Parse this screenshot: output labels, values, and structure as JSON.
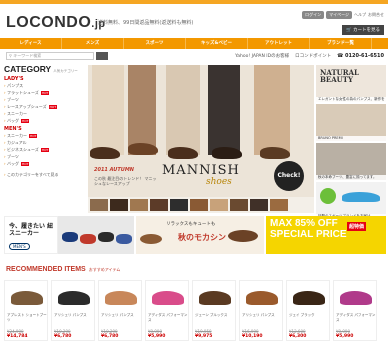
{
  "header": {
    "logo": "LOCONDO",
    "logo_suffix": ".jp",
    "tagline": "送料無料、99日間返品無料(返送料も無料)",
    "login_label": "ログイン",
    "register_label": "マイページ",
    "help_label": "ヘルプ",
    "guide_label": "お問合せ",
    "cart_label": "カートを見る"
  },
  "nav": {
    "items": [
      "レディース",
      "メンズ",
      "スポーツ",
      "キッズ&ベビー",
      "アウトレット",
      "ブランド一覧"
    ]
  },
  "searchbar": {
    "placeholder": "キーワード検索",
    "yahoo_label": "Yahoo! JAPAN IDのお客様",
    "point_label": "ロコンドポイント",
    "phone": "0120-61-6510"
  },
  "sidebar": {
    "title": "CATEGORY",
    "subtitle": "人気カテゴリー",
    "ladies_title": "LADY'S",
    "ladies_items": [
      "パンプス",
      "フラットシューズ",
      "ブーツ",
      "レースアップシューズ",
      "スニーカー",
      "バッグ"
    ],
    "ladies_hot": [
      false,
      true,
      false,
      true,
      false,
      true
    ],
    "mens_title": "MEN'S",
    "mens_items": [
      "スニーカー",
      "カジュアル",
      "ビジネスシューズ",
      "ブーツ",
      "バッグ"
    ],
    "mens_hot": [
      true,
      false,
      true,
      false,
      true
    ],
    "more_label": "このカテゴリーをすべて見る"
  },
  "hero": {
    "season": "2011 AUTUMN",
    "season_sub": "この秋 最注目のトレンド！ マニッシュなレースアップ",
    "title": "MANNISH",
    "title_script": "shoes",
    "check_label": "Check!"
  },
  "rightcol": {
    "promo1_title": "NATURAL BEAUTY",
    "promo1_caption": "エレガントな女性の為のパンプス、新作を",
    "promo2_caption": "BRUNO PREMI",
    "promo3_caption": "秋の本命ブーツ、豊富に揃ってます。",
    "promo4_caption": "話題のスポーツブランドをお届け"
  },
  "banners": {
    "b1_text": "今、履きたい 紐スニーカー",
    "b1_badge": "MEN'S",
    "b3_text": "リラックスもキュートも",
    "b3_title": "秋のモカシン",
    "b4_line1": "MAX 85% OFF",
    "b4_line2": "SPECIAL PRICE",
    "b4_badge": "超特価"
  },
  "recommended": {
    "title": "RECOMMENDED ITEMS",
    "subtitle": "おすすめアイテム",
    "products": [
      {
        "name": "アブレスト ショートブーツ",
        "price": "¥24,990",
        "sale": "¥14,784",
        "color": "#7a5a3a"
      },
      {
        "name": "アリシェリ パンプス",
        "price": "¥10,290",
        "sale": "¥6,780",
        "color": "#2b2b2b"
      },
      {
        "name": "アリシェリ パンプス",
        "price": "¥10,290",
        "sale": "¥6,780",
        "color": "#c8875a"
      },
      {
        "name": "アディダス パフォーマンス",
        "price": "¥9,990",
        "sale": "¥5,990",
        "color": "#d94c8a"
      },
      {
        "name": "ジェーン ブルックス",
        "price": "¥19,950",
        "sale": "¥9,975",
        "color": "#5a3a22"
      },
      {
        "name": "アリシェリ パンプス",
        "price": "¥16,990",
        "sale": "¥10,190",
        "color": "#9a5a2c"
      },
      {
        "name": "ジェイ ブラック",
        "price": "¥12,600",
        "sale": "¥6,300",
        "color": "#3a2616"
      },
      {
        "name": "アディダス パフォーマンス",
        "price": "¥9,990",
        "sale": "¥5,990",
        "color": "#b03a8a"
      }
    ]
  },
  "colors": {
    "accent": "#f39800",
    "sale_red": "#e60012",
    "title_red": "#c0392b"
  }
}
